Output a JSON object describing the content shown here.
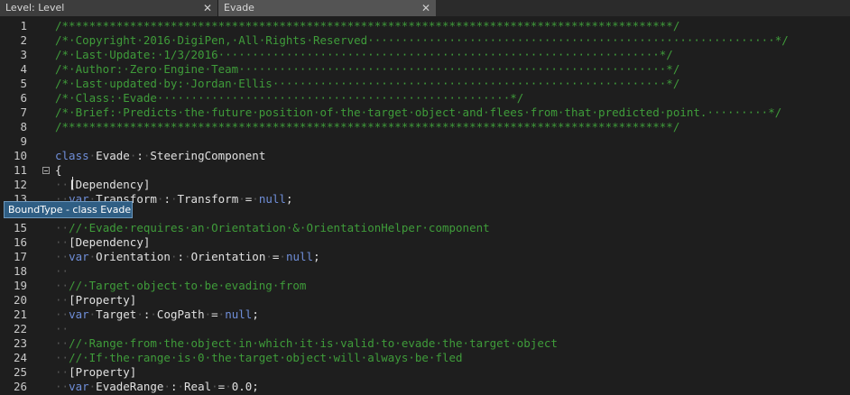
{
  "tabs": [
    {
      "label": "Level: Level",
      "close": "✕",
      "active": false
    },
    {
      "label": "Evade",
      "close": "✕",
      "active": true
    }
  ],
  "tooltip": "BoundType - class Evade",
  "lines": [
    {
      "n": "1",
      "segs": [
        {
          "c": "c",
          "t": "/******************************************************************************************/"
        }
      ]
    },
    {
      "n": "2",
      "segs": [
        {
          "c": "c",
          "t": "/*·Copyright·2016·DigiPen,·All·Rights·Reserved····························································*/"
        }
      ]
    },
    {
      "n": "3",
      "segs": [
        {
          "c": "c",
          "t": "/*·Last·Update:·1/3/2016·································································*/"
        }
      ]
    },
    {
      "n": "4",
      "segs": [
        {
          "c": "c",
          "t": "/*·Author:·Zero·Engine·Team·······························································*/"
        }
      ]
    },
    {
      "n": "5",
      "segs": [
        {
          "c": "c",
          "t": "/*·Last·updated·by:·Jordan·Ellis··························································*/"
        }
      ]
    },
    {
      "n": "6",
      "segs": [
        {
          "c": "c",
          "t": "/*·Class:·Evade····················································*/"
        }
      ]
    },
    {
      "n": "7",
      "segs": [
        {
          "c": "c",
          "t": "/*·Brief:·Predicts·the·future·position·of·the·target·object·and·flees·from·that·predicted·point.·········*/"
        }
      ]
    },
    {
      "n": "8",
      "segs": [
        {
          "c": "c",
          "t": "/******************************************************************************************/"
        }
      ]
    },
    {
      "n": "9",
      "segs": []
    },
    {
      "n": "10",
      "segs": [
        {
          "c": "k",
          "t": "class"
        },
        {
          "c": "ws",
          "t": "·"
        },
        {
          "c": "p",
          "t": "Evade"
        },
        {
          "c": "ws",
          "t": "·"
        },
        {
          "c": "p",
          "t": ":"
        },
        {
          "c": "ws",
          "t": "·"
        },
        {
          "c": "p",
          "t": "SteeringComponent"
        }
      ]
    },
    {
      "n": "11",
      "fold": true,
      "segs": [
        {
          "c": "p",
          "t": "{"
        }
      ]
    },
    {
      "n": "12",
      "segs": [
        {
          "c": "ws",
          "t": "··"
        },
        {
          "c": "p",
          "t": "[Dependency]"
        }
      ]
    },
    {
      "n": "13",
      "segs": [
        {
          "c": "ws",
          "t": "··"
        },
        {
          "c": "k",
          "t": "var"
        },
        {
          "c": "ws",
          "t": "·"
        },
        {
          "c": "p",
          "t": "Transform"
        },
        {
          "c": "ws",
          "t": "·"
        },
        {
          "c": "p",
          "t": ":"
        },
        {
          "c": "ws",
          "t": "·"
        },
        {
          "c": "p",
          "t": "Transform"
        },
        {
          "c": "ws",
          "t": "·"
        },
        {
          "c": "p",
          "t": "="
        },
        {
          "c": "ws",
          "t": "·"
        },
        {
          "c": "k",
          "t": "null"
        },
        {
          "c": "p",
          "t": ";"
        }
      ]
    },
    {
      "n": "14",
      "segs": []
    },
    {
      "n": "15",
      "segs": [
        {
          "c": "ws",
          "t": "··"
        },
        {
          "c": "c",
          "t": "//·Evade·requires·an·Orientation·&·OrientationHelper·component"
        }
      ]
    },
    {
      "n": "16",
      "segs": [
        {
          "c": "ws",
          "t": "··"
        },
        {
          "c": "p",
          "t": "[Dependency]"
        }
      ]
    },
    {
      "n": "17",
      "segs": [
        {
          "c": "ws",
          "t": "··"
        },
        {
          "c": "k",
          "t": "var"
        },
        {
          "c": "ws",
          "t": "·"
        },
        {
          "c": "p",
          "t": "Orientation"
        },
        {
          "c": "ws",
          "t": "·"
        },
        {
          "c": "p",
          "t": ":"
        },
        {
          "c": "ws",
          "t": "·"
        },
        {
          "c": "p",
          "t": "Orientation"
        },
        {
          "c": "ws",
          "t": "·"
        },
        {
          "c": "p",
          "t": "="
        },
        {
          "c": "ws",
          "t": "·"
        },
        {
          "c": "k",
          "t": "null"
        },
        {
          "c": "p",
          "t": ";"
        }
      ]
    },
    {
      "n": "18",
      "segs": [
        {
          "c": "ws",
          "t": "··"
        }
      ]
    },
    {
      "n": "19",
      "segs": [
        {
          "c": "ws",
          "t": "··"
        },
        {
          "c": "c",
          "t": "//·Target·object·to·be·evading·from"
        }
      ]
    },
    {
      "n": "20",
      "segs": [
        {
          "c": "ws",
          "t": "··"
        },
        {
          "c": "p",
          "t": "[Property]"
        }
      ]
    },
    {
      "n": "21",
      "segs": [
        {
          "c": "ws",
          "t": "··"
        },
        {
          "c": "k",
          "t": "var"
        },
        {
          "c": "ws",
          "t": "·"
        },
        {
          "c": "p",
          "t": "Target"
        },
        {
          "c": "ws",
          "t": "·"
        },
        {
          "c": "p",
          "t": ":"
        },
        {
          "c": "ws",
          "t": "·"
        },
        {
          "c": "p",
          "t": "CogPath"
        },
        {
          "c": "ws",
          "t": "·"
        },
        {
          "c": "p",
          "t": "="
        },
        {
          "c": "ws",
          "t": "·"
        },
        {
          "c": "k",
          "t": "null"
        },
        {
          "c": "p",
          "t": ";"
        }
      ]
    },
    {
      "n": "22",
      "segs": [
        {
          "c": "ws",
          "t": "··"
        }
      ]
    },
    {
      "n": "23",
      "segs": [
        {
          "c": "ws",
          "t": "··"
        },
        {
          "c": "c",
          "t": "//·Range·from·the·object·in·which·it·is·valid·to·evade·the·target·object"
        }
      ]
    },
    {
      "n": "24",
      "segs": [
        {
          "c": "ws",
          "t": "··"
        },
        {
          "c": "c",
          "t": "//·If·the·range·is·0·the·target·object·will·always·be·fled"
        }
      ]
    },
    {
      "n": "25",
      "segs": [
        {
          "c": "ws",
          "t": "··"
        },
        {
          "c": "p",
          "t": "[Property]"
        }
      ]
    },
    {
      "n": "26",
      "segs": [
        {
          "c": "ws",
          "t": "··"
        },
        {
          "c": "k",
          "t": "var"
        },
        {
          "c": "ws",
          "t": "·"
        },
        {
          "c": "p",
          "t": "EvadeRange"
        },
        {
          "c": "ws",
          "t": "·"
        },
        {
          "c": "p",
          "t": ":"
        },
        {
          "c": "ws",
          "t": "·"
        },
        {
          "c": "p",
          "t": "Real"
        },
        {
          "c": "ws",
          "t": "·"
        },
        {
          "c": "p",
          "t": "="
        },
        {
          "c": "ws",
          "t": "·"
        },
        {
          "c": "p",
          "t": "0.0;"
        }
      ]
    }
  ]
}
